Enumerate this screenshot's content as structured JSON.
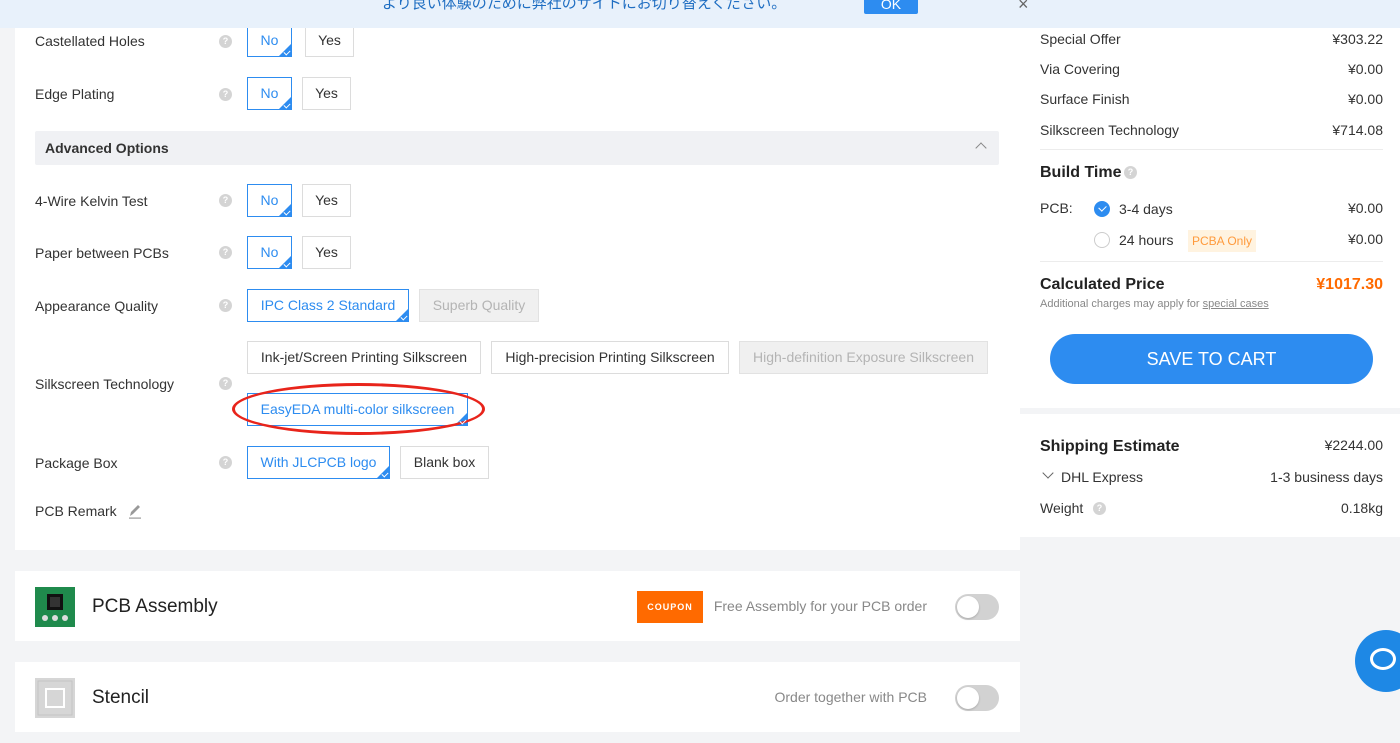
{
  "banner": {
    "text": "より良い体験のために弊社のサイトにお切り替えください。",
    "ok_label": "OK",
    "close_icon": "×"
  },
  "options": {
    "castellated_holes": {
      "label": "Castellated Holes",
      "choices": [
        "No",
        "Yes"
      ],
      "selected": "No"
    },
    "edge_plating": {
      "label": "Edge Plating",
      "choices": [
        "No",
        "Yes"
      ],
      "selected": "No"
    },
    "advanced_title": "Advanced Options",
    "kelvin_test": {
      "label": "4-Wire Kelvin Test",
      "choices": [
        "No",
        "Yes"
      ],
      "selected": "No"
    },
    "paper_between": {
      "label": "Paper between PCBs",
      "choices": [
        "No",
        "Yes"
      ],
      "selected": "No"
    },
    "appearance_quality": {
      "label": "Appearance Quality",
      "choices": [
        "IPC Class 2 Standard",
        "Superb Quality"
      ],
      "selected": "IPC Class 2 Standard"
    },
    "silkscreen_tech": {
      "label": "Silkscreen Technology",
      "choices": [
        "Ink-jet/Screen Printing Silkscreen",
        "High-precision Printing Silkscreen",
        "High-definition Exposure Silkscreen",
        "EasyEDA multi-color silkscreen"
      ],
      "selected": "EasyEDA multi-color silkscreen"
    },
    "package_box": {
      "label": "Package Box",
      "choices": [
        "With JLCPCB logo",
        "Blank box"
      ],
      "selected": "With JLCPCB logo"
    },
    "pcb_remark": {
      "label": "PCB Remark"
    }
  },
  "assembly": {
    "title": "PCB Assembly",
    "coupon": "COUPON",
    "note": "Free Assembly for your PCB order"
  },
  "stencil": {
    "title": "Stencil",
    "note": "Order together with PCB"
  },
  "summary": {
    "items": [
      {
        "label": "Special Offer",
        "value": "¥303.22"
      },
      {
        "label": "Via Covering",
        "value": "¥0.00"
      },
      {
        "label": "Surface Finish",
        "value": "¥0.00"
      },
      {
        "label": "Silkscreen Technology",
        "value": "¥714.08"
      }
    ],
    "build_time": {
      "title": "Build Time",
      "pcb_label": "PCB:",
      "options": [
        {
          "label": "3-4 days",
          "value": "¥0.00",
          "selected": true
        },
        {
          "label": "24 hours",
          "value": "¥0.00",
          "badge": "PCBA Only",
          "selected": false
        }
      ]
    },
    "calculated": {
      "label": "Calculated Price",
      "value": "¥1017.30",
      "note": "Additional charges may apply for ",
      "note_link": "special cases"
    },
    "save_label": "SAVE TO CART"
  },
  "shipping": {
    "title": "Shipping Estimate",
    "value": "¥2244.00",
    "carrier": "DHL Express",
    "carrier_time": "1-3 business days",
    "weight_label": "Weight",
    "weight_value": "0.18kg"
  },
  "colors": {
    "accent": "#2d8cf0",
    "price_orange": "#ff6a00",
    "highlight_red": "#e8241b"
  },
  "icons": {
    "help": "help-icon",
    "pencil": "pencil-icon",
    "chat": "chat-icon"
  }
}
